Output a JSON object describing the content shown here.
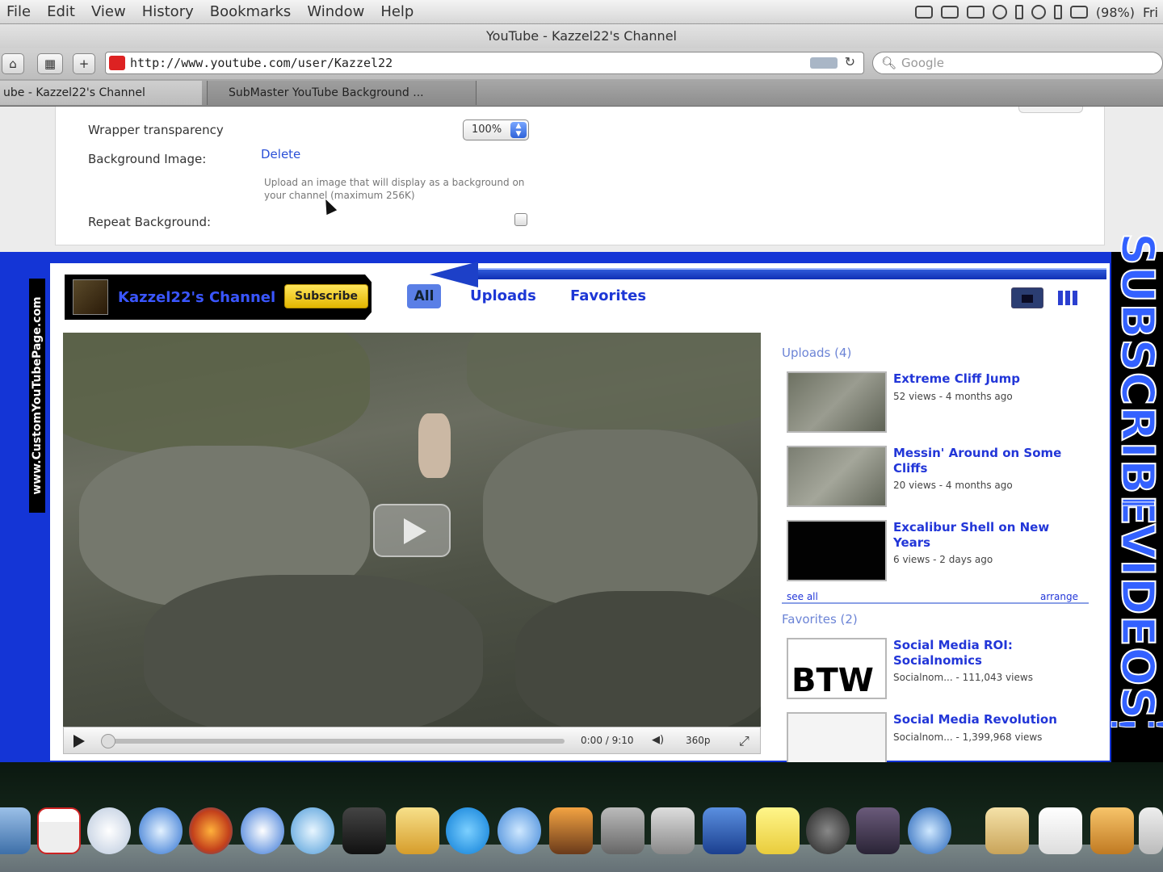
{
  "menubar": {
    "items": [
      "File",
      "Edit",
      "View",
      "History",
      "Bookmarks",
      "Window",
      "Help"
    ],
    "clock": "Fri",
    "battery": "(98%)"
  },
  "browser": {
    "window_title": "YouTube - Kazzel22's Channel",
    "url": "http://www.youtube.com/user/Kazzel22",
    "search_placeholder": "Google",
    "tabs": [
      "ube - Kazzel22's Channel",
      "SubMaster YouTube Background ..."
    ]
  },
  "settings": {
    "wrapper_label": "Wrapper transparency",
    "wrapper_value": "100%",
    "bg_image_label": "Background Image:",
    "delete_link": "Delete",
    "help_text": "Upload an image that will display as a background on your channel (maximum 256K)",
    "repeat_label": "Repeat Background:"
  },
  "background": {
    "side_text": "www.CustomYouTubePage.com",
    "subscribe_text": "SUBSCRIBE",
    "separator": "|",
    "videos_text": "VIDEOS",
    "trailing_bars": "! !"
  },
  "channel": {
    "name": "Kazzel22's Channel",
    "subscribe_label": "Subscribe",
    "nav": {
      "all": "All",
      "uploads": "Uploads",
      "favorites": "Favorites"
    }
  },
  "player": {
    "time": "0:00 / 9:10",
    "quality": "360p"
  },
  "uploads": {
    "header": "Uploads (4)",
    "items": [
      {
        "title": "Extreme Cliff Jump",
        "meta": "52 views - 4 months ago"
      },
      {
        "title": "Messin' Around on Some Cliffs",
        "meta": "20 views - 4 months ago"
      },
      {
        "title": "Excalibur Shell on New Years",
        "meta": "6 views - 2 days ago"
      }
    ],
    "see_all": "see all",
    "arrange": "arrange"
  },
  "favorites": {
    "header": "Favorites (2)",
    "items": [
      {
        "title": "Social Media ROI: Socialnomics",
        "meta": "Socialnom... - 111,043 views",
        "thumb_text": "BTW"
      },
      {
        "title": "Social Media Revolution",
        "meta": "Socialnom... - 1,399,968 views"
      }
    ]
  },
  "colors": {
    "channel_background": "#1435d6",
    "link_blue": "#2236d8",
    "subscribe_yellow": "#f2cc1a"
  }
}
